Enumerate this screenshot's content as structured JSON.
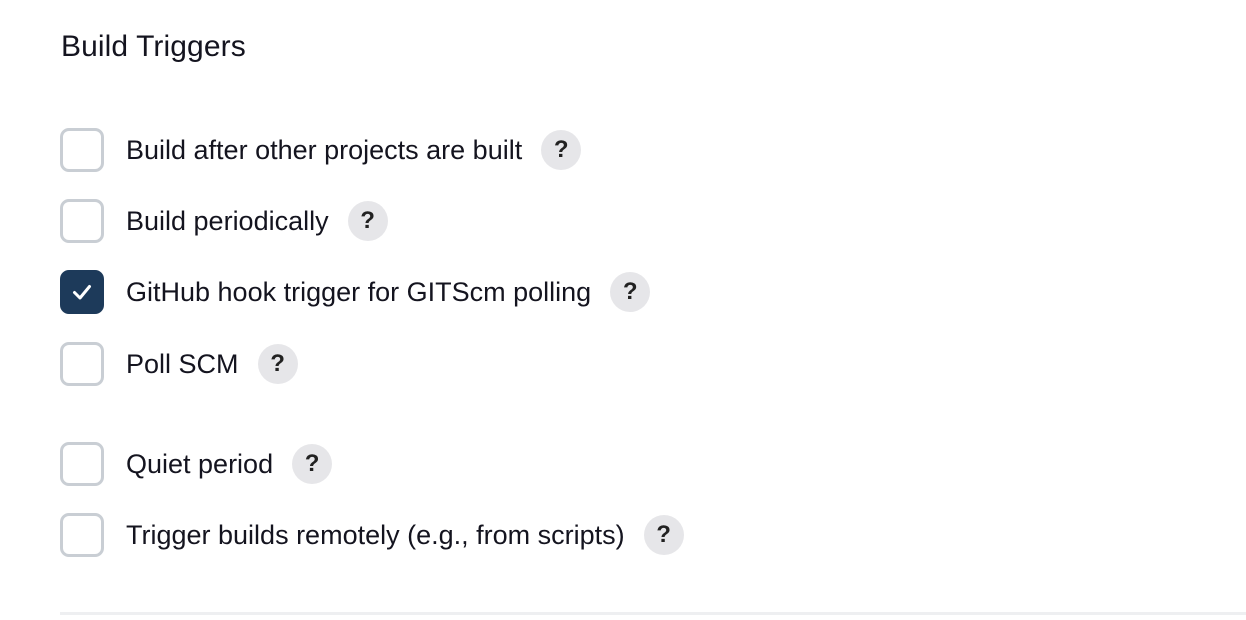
{
  "section": {
    "title": "Build Triggers"
  },
  "triggers": [
    {
      "label": "Build after other projects are built",
      "checked": false,
      "help": "?"
    },
    {
      "label": "Build periodically",
      "checked": false,
      "help": "?"
    },
    {
      "label": "GitHub hook trigger for GITScm polling",
      "checked": true,
      "help": "?"
    },
    {
      "label": "Poll SCM",
      "checked": false,
      "help": "?"
    },
    {
      "label": "Quiet period",
      "checked": false,
      "help": "?"
    },
    {
      "label": "Trigger builds remotely (e.g., from scripts)",
      "checked": false,
      "help": "?"
    }
  ],
  "colors": {
    "checked_fill": "#1d3a5a",
    "unchecked_border": "#c9ced4",
    "help_bg": "#e6e6e9"
  },
  "icons": {
    "checkmark": "check-icon"
  }
}
